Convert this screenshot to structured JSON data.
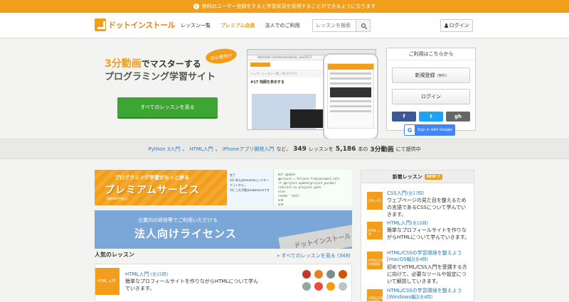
{
  "banner": {
    "text": "無料のユーザー登録をすると学習状況を管理することができるようになります"
  },
  "nav": {
    "logo": "ドットインストール",
    "links": [
      "レッスン一覧",
      "プレミアム会員",
      "法人でのご利用"
    ],
    "search_placeholder": "レッスンを検索",
    "login": "ログイン"
  },
  "hero": {
    "tag_highlight": "3分動画",
    "tag_rest": "でマスターする",
    "tag_line2": "プログラミング学習サイト",
    "badge": "初心者向け",
    "cta": "すべてのレッスンを見る",
    "screenshot": {
      "url": "dotinstall.com/lessons/basic_osx/4117",
      "crumb": "トップ › レッスン一覧 › OS Xアプリ",
      "title": "#17 地図を表示する"
    }
  },
  "register": {
    "heading": "ご利用はこちらから",
    "signup": "新規登録",
    "signup_note": "(無料)",
    "login": "ログイン",
    "socials": [
      "f",
      "t",
      "gh"
    ],
    "google": "Sign in with Google"
  },
  "stats": {
    "langs": [
      "Python 3入門",
      "HTML入門",
      "iPhoneアプリ開発入門"
    ],
    "sep": "、",
    "mid": "など、",
    "lessons": "349",
    "lessons_unit": "レッスンを",
    "videos": "5,186",
    "videos_unit": "本の",
    "videos_tag": "3分動画",
    "tail": "にて提供中"
  },
  "premium": {
    "top": "プログラミング学習がもっと捗る",
    "main": "プレミアムサービス",
    "small": "月額980円(税込)",
    "code_left": [
      "完了",
      "1行 例えばrenameというターゲットから...",
      "1行 これが実はnakamuraです"
    ],
    "code_right": [
      "def update",
      "  @project = Project.find(params[:id])",
      "  if @project.update(project_params)",
      "    redirect_to projects_path",
      "  else",
      "    render 'edit'",
      "  end",
      "end"
    ]
  },
  "corporate": {
    "sub": "企業内の研修等でご利用いただける",
    "main": "法人向けライセンス",
    "logo": "ドットインストール"
  },
  "popular": {
    "title": "人気のレッスン",
    "all": "» すべてのレッスンを見る (349)",
    "item": {
      "thumb": "HTML 入門",
      "name": "HTML入門",
      "count": "(全15回)",
      "desc": "簡単なプロフィールサイトを作りながらHTMLについて学んでいきます。"
    }
  },
  "new_lessons": {
    "title": "新着レッスン",
    "badge": "NEW !!",
    "items": [
      {
        "thumb": "CSS 入門",
        "name": "CSS入門",
        "count": "(全17回)",
        "desc": "ウェブページの見た目を整えるための言語であるCSSについて学んでいきます。"
      },
      {
        "thumb": "HTML 入門",
        "name": "HTML入門",
        "count": "(全15回)",
        "desc": "簡単なプロフィールサイトを作りながらHTMLについて学んでいきます。"
      },
      {
        "thumb": "HTML/CSS 学習環境",
        "name": "HTML/CSSの学習環境を整えよう [macOS編]",
        "count": "(全4回)",
        "desc": "初めてHTML/CSS入門を受講する方に向けて、必要なツールや設定について解説していきます。"
      },
      {
        "thumb": "HTML/CSS 学習環境",
        "name": "HTML/CSSの学習環境を整えよう [Windows編]",
        "count": "(全4回)",
        "desc": ""
      }
    ]
  },
  "colors": {
    "accent": "#f29e1d",
    "link": "#2a7ab8",
    "green": "#3da534",
    "facebook": "#3b5998",
    "twitter": "#1da1f2",
    "github": "#666666"
  }
}
